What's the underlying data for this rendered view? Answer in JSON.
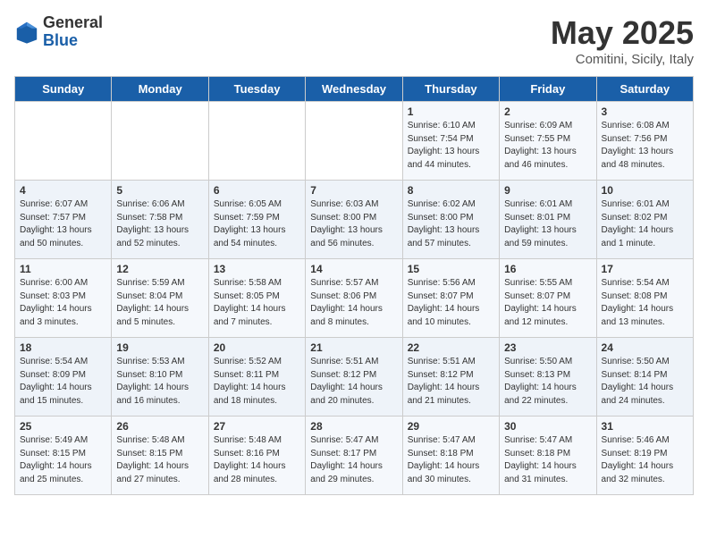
{
  "logo": {
    "general": "General",
    "blue": "Blue"
  },
  "title": {
    "month": "May 2025",
    "location": "Comitini, Sicily, Italy"
  },
  "headers": [
    "Sunday",
    "Monday",
    "Tuesday",
    "Wednesday",
    "Thursday",
    "Friday",
    "Saturday"
  ],
  "weeks": [
    [
      {
        "day": "",
        "text": ""
      },
      {
        "day": "",
        "text": ""
      },
      {
        "day": "",
        "text": ""
      },
      {
        "day": "",
        "text": ""
      },
      {
        "day": "1",
        "text": "Sunrise: 6:10 AM\nSunset: 7:54 PM\nDaylight: 13 hours\nand 44 minutes."
      },
      {
        "day": "2",
        "text": "Sunrise: 6:09 AM\nSunset: 7:55 PM\nDaylight: 13 hours\nand 46 minutes."
      },
      {
        "day": "3",
        "text": "Sunrise: 6:08 AM\nSunset: 7:56 PM\nDaylight: 13 hours\nand 48 minutes."
      }
    ],
    [
      {
        "day": "4",
        "text": "Sunrise: 6:07 AM\nSunset: 7:57 PM\nDaylight: 13 hours\nand 50 minutes."
      },
      {
        "day": "5",
        "text": "Sunrise: 6:06 AM\nSunset: 7:58 PM\nDaylight: 13 hours\nand 52 minutes."
      },
      {
        "day": "6",
        "text": "Sunrise: 6:05 AM\nSunset: 7:59 PM\nDaylight: 13 hours\nand 54 minutes."
      },
      {
        "day": "7",
        "text": "Sunrise: 6:03 AM\nSunset: 8:00 PM\nDaylight: 13 hours\nand 56 minutes."
      },
      {
        "day": "8",
        "text": "Sunrise: 6:02 AM\nSunset: 8:00 PM\nDaylight: 13 hours\nand 57 minutes."
      },
      {
        "day": "9",
        "text": "Sunrise: 6:01 AM\nSunset: 8:01 PM\nDaylight: 13 hours\nand 59 minutes."
      },
      {
        "day": "10",
        "text": "Sunrise: 6:01 AM\nSunset: 8:02 PM\nDaylight: 14 hours\nand 1 minute."
      }
    ],
    [
      {
        "day": "11",
        "text": "Sunrise: 6:00 AM\nSunset: 8:03 PM\nDaylight: 14 hours\nand 3 minutes."
      },
      {
        "day": "12",
        "text": "Sunrise: 5:59 AM\nSunset: 8:04 PM\nDaylight: 14 hours\nand 5 minutes."
      },
      {
        "day": "13",
        "text": "Sunrise: 5:58 AM\nSunset: 8:05 PM\nDaylight: 14 hours\nand 7 minutes."
      },
      {
        "day": "14",
        "text": "Sunrise: 5:57 AM\nSunset: 8:06 PM\nDaylight: 14 hours\nand 8 minutes."
      },
      {
        "day": "15",
        "text": "Sunrise: 5:56 AM\nSunset: 8:07 PM\nDaylight: 14 hours\nand 10 minutes."
      },
      {
        "day": "16",
        "text": "Sunrise: 5:55 AM\nSunset: 8:07 PM\nDaylight: 14 hours\nand 12 minutes."
      },
      {
        "day": "17",
        "text": "Sunrise: 5:54 AM\nSunset: 8:08 PM\nDaylight: 14 hours\nand 13 minutes."
      }
    ],
    [
      {
        "day": "18",
        "text": "Sunrise: 5:54 AM\nSunset: 8:09 PM\nDaylight: 14 hours\nand 15 minutes."
      },
      {
        "day": "19",
        "text": "Sunrise: 5:53 AM\nSunset: 8:10 PM\nDaylight: 14 hours\nand 16 minutes."
      },
      {
        "day": "20",
        "text": "Sunrise: 5:52 AM\nSunset: 8:11 PM\nDaylight: 14 hours\nand 18 minutes."
      },
      {
        "day": "21",
        "text": "Sunrise: 5:51 AM\nSunset: 8:12 PM\nDaylight: 14 hours\nand 20 minutes."
      },
      {
        "day": "22",
        "text": "Sunrise: 5:51 AM\nSunset: 8:12 PM\nDaylight: 14 hours\nand 21 minutes."
      },
      {
        "day": "23",
        "text": "Sunrise: 5:50 AM\nSunset: 8:13 PM\nDaylight: 14 hours\nand 22 minutes."
      },
      {
        "day": "24",
        "text": "Sunrise: 5:50 AM\nSunset: 8:14 PM\nDaylight: 14 hours\nand 24 minutes."
      }
    ],
    [
      {
        "day": "25",
        "text": "Sunrise: 5:49 AM\nSunset: 8:15 PM\nDaylight: 14 hours\nand 25 minutes."
      },
      {
        "day": "26",
        "text": "Sunrise: 5:48 AM\nSunset: 8:15 PM\nDaylight: 14 hours\nand 27 minutes."
      },
      {
        "day": "27",
        "text": "Sunrise: 5:48 AM\nSunset: 8:16 PM\nDaylight: 14 hours\nand 28 minutes."
      },
      {
        "day": "28",
        "text": "Sunrise: 5:47 AM\nSunset: 8:17 PM\nDaylight: 14 hours\nand 29 minutes."
      },
      {
        "day": "29",
        "text": "Sunrise: 5:47 AM\nSunset: 8:18 PM\nDaylight: 14 hours\nand 30 minutes."
      },
      {
        "day": "30",
        "text": "Sunrise: 5:47 AM\nSunset: 8:18 PM\nDaylight: 14 hours\nand 31 minutes."
      },
      {
        "day": "31",
        "text": "Sunrise: 5:46 AM\nSunset: 8:19 PM\nDaylight: 14 hours\nand 32 minutes."
      }
    ]
  ]
}
